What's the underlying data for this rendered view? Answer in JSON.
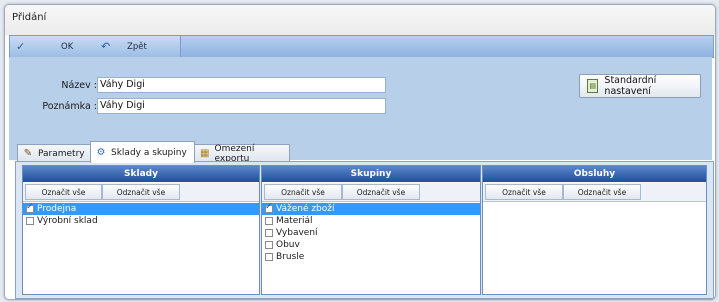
{
  "window": {
    "title": "Přidání"
  },
  "toolbar": {
    "ok_label": "OK",
    "back_label": "Zpět"
  },
  "form": {
    "name_label": "Název :",
    "name_value": "Váhy Digi",
    "note_label": "Poznámka :",
    "note_value": "Váhy Digi",
    "standard_settings_label": "Standardní nastavení"
  },
  "tabs": [
    {
      "label": "Parametry",
      "icon": "params-icon",
      "active": false
    },
    {
      "label": "Sklady a skupiny",
      "icon": "warehouse-icon",
      "active": true
    },
    {
      "label": "Omezení exportu",
      "icon": "export-icon",
      "active": false
    }
  ],
  "panels": {
    "sklady": {
      "title": "Sklady",
      "select_all": "Označit vše",
      "deselect_all": "Odznačit vše",
      "items": [
        {
          "label": "Prodejna",
          "checked": true,
          "selected": true
        },
        {
          "label": "Výrobní sklad",
          "checked": false,
          "selected": false
        }
      ]
    },
    "skupiny": {
      "title": "Skupiny",
      "select_all": "Označit vše",
      "deselect_all": "Odznačit vše",
      "items": [
        {
          "label": "Vážené zboží",
          "checked": true,
          "selected": true
        },
        {
          "label": "Materiál",
          "checked": false,
          "selected": false
        },
        {
          "label": "Vybavení",
          "checked": false,
          "selected": false
        },
        {
          "label": "Obuv",
          "checked": false,
          "selected": false
        },
        {
          "label": "Brusle",
          "checked": false,
          "selected": false
        }
      ]
    },
    "obsluhy": {
      "title": "Obsluhy",
      "select_all": "Označit vše",
      "deselect_all": "Odznačit vše",
      "items": []
    }
  }
}
